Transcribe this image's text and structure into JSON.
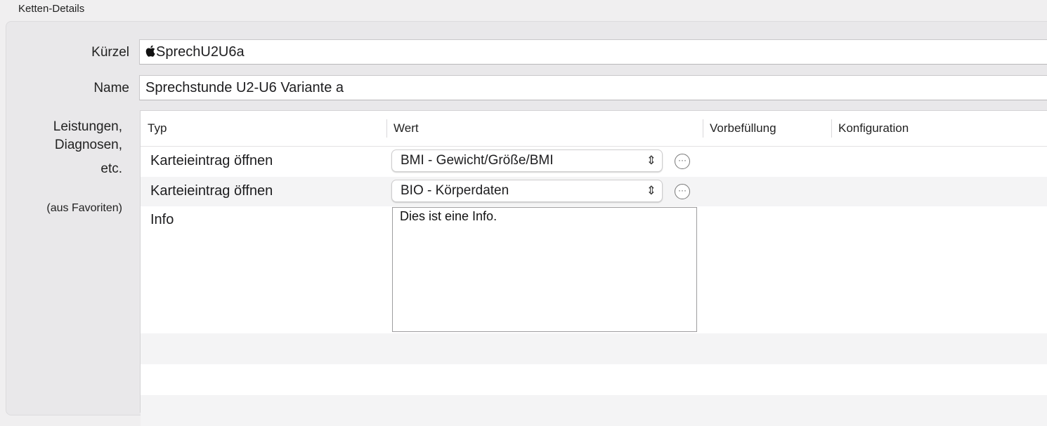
{
  "section": {
    "title": "Ketten-Details"
  },
  "form": {
    "kuerzel_label": "Kürzel",
    "kuerzel_value": "SprechU2U6a",
    "name_label": "Name",
    "name_value": "Sprechstunde U2-U6 Variante a",
    "leistungen_label_1": "Leistungen,",
    "leistungen_label_2": "Diagnosen,",
    "leistungen_label_3": "etc.",
    "favoriten_note": "(aus Favoriten)"
  },
  "table": {
    "columns": [
      "Typ",
      "Wert",
      "Vorbefüllung",
      "Konfiguration"
    ],
    "rows": [
      {
        "typ": "Karteieintrag öffnen",
        "wert": "BMI - Gewicht/Größe/BMI"
      },
      {
        "typ": "Karteieintrag öffnen",
        "wert": "BIO - Körperdaten"
      },
      {
        "typ": "Info",
        "wert": "Dies ist eine Info."
      }
    ]
  },
  "icons": {
    "apple": "apple-logo-icon",
    "popup_chevron": "updown-chevron-icon",
    "more": "ellipsis-circle-icon"
  }
}
